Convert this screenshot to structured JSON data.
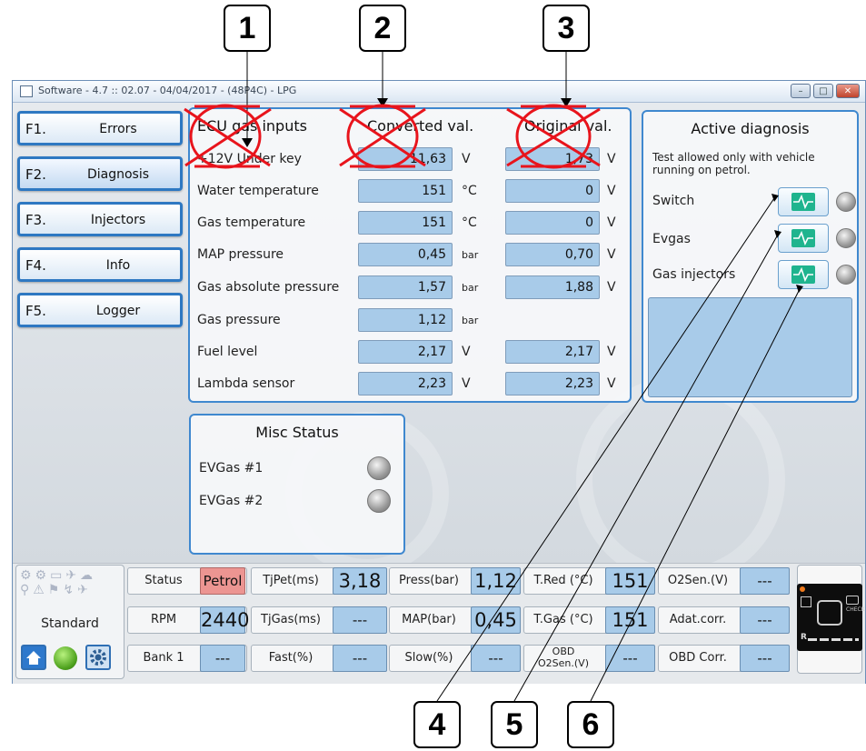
{
  "callouts": [
    "1",
    "2",
    "3",
    "4",
    "5",
    "6"
  ],
  "window": {
    "title": "Software - 4.7 :: 02.07 - 04/04/2017 - (48P4C) - LPG",
    "buttons": {
      "minimize": "–",
      "maximize": "□",
      "close": "✕"
    }
  },
  "nav": [
    {
      "key": "F1.",
      "label": "Errors"
    },
    {
      "key": "F2.",
      "label": "Diagnosis"
    },
    {
      "key": "F3.",
      "label": "Injectors"
    },
    {
      "key": "F4.",
      "label": "Info"
    },
    {
      "key": "F5.",
      "label": "Logger"
    }
  ],
  "inputs_panel": {
    "headers": {
      "name": "ECU gas inputs",
      "converted": "Converted val.",
      "original": "Original val."
    },
    "rows": [
      {
        "label": "+12V Under key",
        "conv": "11,63",
        "conv_unit": "V",
        "orig": "1,73",
        "orig_unit": "V"
      },
      {
        "label": "Water temperature",
        "conv": "151",
        "conv_unit": "°C",
        "orig": "0",
        "orig_unit": "V"
      },
      {
        "label": "Gas temperature",
        "conv": "151",
        "conv_unit": "°C",
        "orig": "0",
        "orig_unit": "V"
      },
      {
        "label": "MAP pressure",
        "conv": "0,45",
        "conv_unit": "bar",
        "orig": "0,70",
        "orig_unit": "V"
      },
      {
        "label": "Gas absolute pressure",
        "conv": "1,57",
        "conv_unit": "bar",
        "orig": "1,88",
        "orig_unit": "V"
      },
      {
        "label": "Gas pressure",
        "conv": "1,12",
        "conv_unit": "bar",
        "orig": "",
        "orig_unit": ""
      },
      {
        "label": "Fuel level",
        "conv": "2,17",
        "conv_unit": "V",
        "orig": "2,17",
        "orig_unit": "V"
      },
      {
        "label": "Lambda sensor",
        "conv": "2,23",
        "conv_unit": "V",
        "orig": "2,23",
        "orig_unit": "V"
      }
    ]
  },
  "active_diagnosis": {
    "title": "Active diagnosis",
    "note": "Test allowed only with vehicle running on petrol.",
    "items": [
      "Switch",
      "Evgas",
      "Gas injectors"
    ]
  },
  "misc_status": {
    "title": "Misc Status",
    "items": [
      "EVGas #1",
      "EVGas #2"
    ]
  },
  "statusbar": {
    "mode": "Standard",
    "row1": [
      {
        "label": "Status",
        "value": "Petrol",
        "accent": "#ec9592"
      },
      {
        "label": "TjPet(ms)",
        "value": "3,18"
      },
      {
        "label": "Press(bar)",
        "value": "1,12"
      },
      {
        "label": "T.Red (°C)",
        "value": "151"
      },
      {
        "label": "O2Sen.(V)",
        "value": "---"
      }
    ],
    "row2": [
      {
        "label": "RPM",
        "value": "2440"
      },
      {
        "label": "TjGas(ms)",
        "value": "---"
      },
      {
        "label": "MAP(bar)",
        "value": "0,45"
      },
      {
        "label": "T.Gas (°C)",
        "value": "151"
      },
      {
        "label": "Adat.corr.",
        "value": "---"
      }
    ],
    "row3": [
      {
        "label": "Bank 1",
        "value": "---"
      },
      {
        "label": "Fast(%)",
        "value": "---"
      },
      {
        "label": "Slow(%)",
        "value": "---"
      },
      {
        "label": "OBD O2Sen.(V)",
        "value": "---"
      },
      {
        "label": "OBD Corr.",
        "value": "---"
      }
    ],
    "dash_text": {
      "check": "CHECK",
      "reverse": "R"
    }
  },
  "colors": {
    "accent": "#3f88cf",
    "value_box": "#a8cbe9",
    "test_button": "#1fb48e",
    "annotation_mark": "#e8141c"
  }
}
